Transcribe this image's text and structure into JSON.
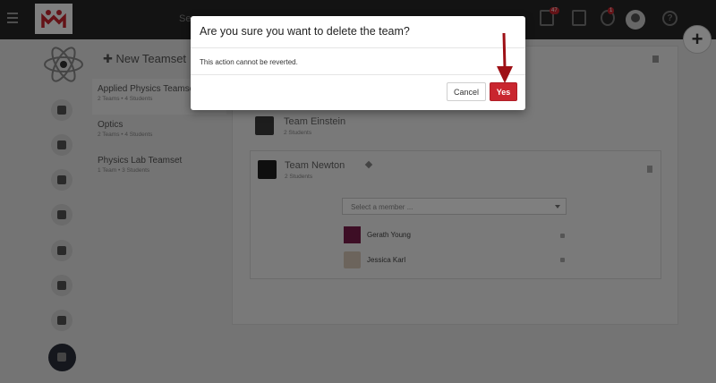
{
  "header": {
    "search_hint": "Se",
    "notification_badges": [
      "47",
      "1"
    ]
  },
  "teamsets": {
    "new_label": "New Teamset",
    "items": [
      {
        "name": "Applied Physics Teamset",
        "meta": "2 Teams • 4 Students"
      },
      {
        "name": "Optics",
        "meta": "2 Teams • 4 Students"
      },
      {
        "name": "Physics Lab Teamset",
        "meta": "1 Team • 3 Students"
      }
    ]
  },
  "teams": [
    {
      "name": "Team Einstein",
      "meta": "2 Students"
    },
    {
      "name": "Team Newton",
      "meta": "2 Students"
    }
  ],
  "member_select": {
    "placeholder": "Select a member ..."
  },
  "members": [
    {
      "name": "Gerath Young"
    },
    {
      "name": "Jessica Karl"
    }
  ],
  "modal": {
    "title": "Are you sure you want to delete the team?",
    "body": "This action cannot be reverted.",
    "cancel_label": "Cancel",
    "confirm_label": "Yes"
  },
  "colors": {
    "brand_red": "#c9262f",
    "topbar": "#262626",
    "annotation_arrow": "#9e1016"
  }
}
